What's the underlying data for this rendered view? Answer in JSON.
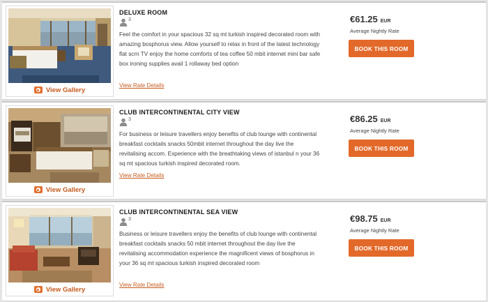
{
  "rooms": [
    {
      "title": "DELUXE ROOM",
      "occupancy": "3",
      "description": "Feel the comfort in your spacious 32 sq mt turkish inspired decorated room with amazing bosphorus view. Allow yourself to relax in front of the latest technology flat scrn TV enjoy the home comforts of tea coffee 50 mbit internet mini bar safe box ironing supplies avail 1 rollaway bed option",
      "rate_details": "View Rate Details",
      "gallery": "View Gallery",
      "price": "€61.25",
      "currency": "EUR",
      "price_note": "Average Nightly Rate",
      "book": "BOOK THIS ROOM"
    },
    {
      "title": "CLUB INTERCONTINENTAL CITY VIEW",
      "occupancy": "3",
      "description": "For business or leisure travellers enjoy benefits of club lounge with continental breakfast cocktails snacks 50mbit internet throughout the day live the revitalising accom. Experience with the breathtaking views of istanbul n your 36 sq mt spacious turkish inspired decorated room.",
      "rate_details": "View Rate Details",
      "gallery": "View Gallery",
      "price": "€86.25",
      "currency": "EUR",
      "price_note": "Average Nightly Rate",
      "book": "BOOK THIS ROOM"
    },
    {
      "title": "CLUB INTERCONTINENTAL SEA VIEW",
      "occupancy": "3",
      "description": "Business or leisure travellers enjoy the benefits of club lounge with continental breakfast cocktails snacks 50 mbit internet throughout the day live the revitalising accommodation experience the magnificent views of bosphorus in your 36 sq mt spacious turkish inspired decorated room",
      "rate_details": "View Rate Details",
      "gallery": "View Gallery",
      "price": "€98.75",
      "currency": "EUR",
      "price_note": "Average Nightly Rate",
      "book": "BOOK THIS ROOM"
    }
  ],
  "icons": {
    "occupancy": "person-icon",
    "gallery": "camera-icon"
  },
  "colors": {
    "accent": "#e2692a",
    "link": "#c65a1e",
    "page_background": "#e4e4e4"
  }
}
